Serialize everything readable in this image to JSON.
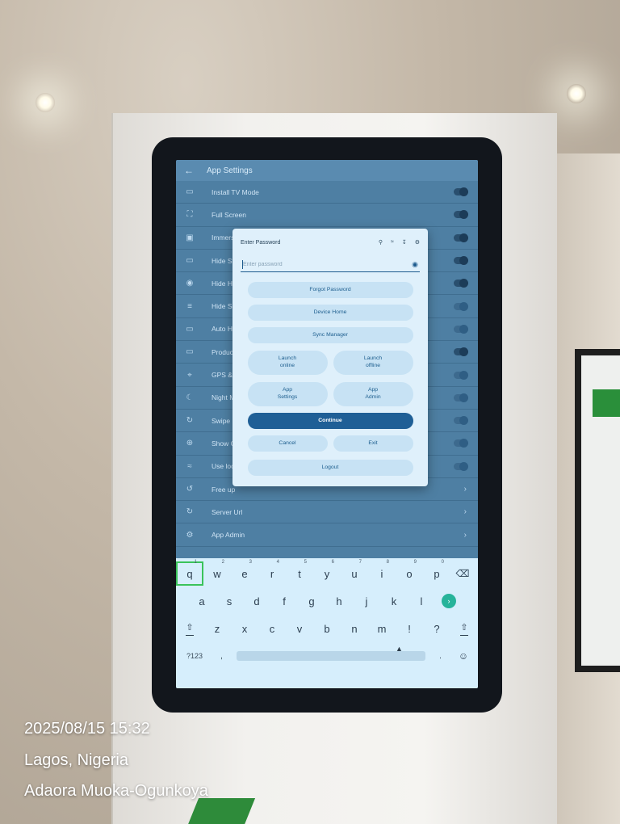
{
  "app_settings": {
    "title": "App Settings",
    "items": [
      {
        "label": "Install TV Mode",
        "icon": "tv-icon",
        "control": "toggle",
        "on": true
      },
      {
        "label": "Full Screen",
        "icon": "fullscreen-icon",
        "control": "toggle",
        "on": true
      },
      {
        "label": "Immersi",
        "icon": "immersive-icon",
        "control": "toggle",
        "on": true
      },
      {
        "label": "Hide Stat",
        "icon": "hide-status-icon",
        "control": "toggle",
        "on": true
      },
      {
        "label": "Hide Hor",
        "icon": "hide-home-icon",
        "control": "toggle",
        "on": true
      },
      {
        "label": "Hide Scr",
        "icon": "hide-scroll-icon",
        "control": "toggle",
        "on": false
      },
      {
        "label": "Auto Hid",
        "icon": "auto-hide-icon",
        "control": "toggle",
        "on": false
      },
      {
        "label": "Product I",
        "icon": "product-icon",
        "control": "toggle",
        "on": true
      },
      {
        "label": "GPS & Lo",
        "icon": "location-pin-icon",
        "control": "toggle",
        "on": false
      },
      {
        "label": "Night Mo",
        "icon": "night-mode-icon",
        "control": "toggle",
        "on": false
      },
      {
        "label": "Swipe Re",
        "icon": "refresh-icon",
        "control": "toggle",
        "on": false
      },
      {
        "label": "Show Off",
        "icon": "crosshair-icon",
        "control": "toggle",
        "on": false
      },
      {
        "label": "Use loca",
        "icon": "wifi-icon",
        "control": "toggle",
        "on": false
      },
      {
        "label": "Free up",
        "icon": "cleanup-icon",
        "control": "chevron"
      },
      {
        "label": "Server Url",
        "icon": "server-icon",
        "control": "chevron"
      },
      {
        "label": "App Admin",
        "icon": "admin-gear-icon",
        "control": "chevron"
      }
    ]
  },
  "dialog": {
    "title": "Enter Password",
    "password_placeholder": "Enter password",
    "forgot_password": "Forgot Password",
    "device_home": "Device Home",
    "sync_manager": "Sync Manager",
    "launch_online": "Launch\nonline",
    "launch_offline": "Launch\noffline",
    "app_settings": "App\nSettings",
    "app_admin": "App\nAdmin",
    "continue": "Continue",
    "cancel": "Cancel",
    "exit": "Exit",
    "logout": "Logout"
  },
  "keyboard": {
    "row1": [
      {
        "k": "q",
        "n": "1"
      },
      {
        "k": "w",
        "n": "2"
      },
      {
        "k": "e",
        "n": "3"
      },
      {
        "k": "r",
        "n": "4"
      },
      {
        "k": "t",
        "n": "5"
      },
      {
        "k": "y",
        "n": "6"
      },
      {
        "k": "u",
        "n": "7"
      },
      {
        "k": "i",
        "n": "8"
      },
      {
        "k": "o",
        "n": "9"
      },
      {
        "k": "p",
        "n": "0"
      }
    ],
    "row2": [
      "a",
      "s",
      "d",
      "f",
      "g",
      "h",
      "j",
      "k",
      "l"
    ],
    "row3": [
      "z",
      "x",
      "c",
      "v",
      "b",
      "n",
      "m",
      "!",
      "?"
    ],
    "symbols_label": "?123",
    "comma": ",",
    "period": "."
  },
  "photo_caption": {
    "datetime": "2025/08/15 15:32",
    "location": "Lagos, Nigeria",
    "author": "Adaora Muoka-Ogunkoya"
  }
}
